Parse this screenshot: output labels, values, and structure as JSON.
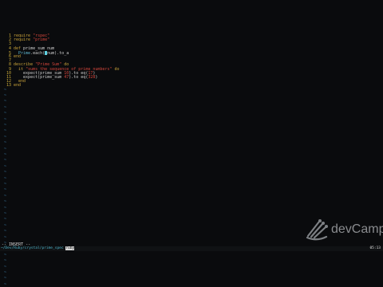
{
  "editor": {
    "lines": [
      {
        "n": "1",
        "segments": [
          {
            "t": "require ",
            "c": "kw"
          },
          {
            "t": "\"rspec\"",
            "c": "str"
          }
        ]
      },
      {
        "n": "2",
        "segments": [
          {
            "t": "require ",
            "c": "kw"
          },
          {
            "t": "\"prime\"",
            "c": "str"
          }
        ]
      },
      {
        "n": "3",
        "segments": []
      },
      {
        "n": "4",
        "segments": [
          {
            "t": "def ",
            "c": "kw"
          },
          {
            "t": "prime_sum ",
            "c": "fn"
          },
          {
            "t": "num",
            "c": "plain"
          }
        ]
      },
      {
        "n": "5",
        "segments": [
          {
            "t": "  Prime",
            "c": "cls"
          },
          {
            "t": ".each(",
            "c": "plain"
          },
          {
            "t": "CURSOR",
            "c": "cursor"
          },
          {
            "t": "num",
            "c": "plain"
          },
          {
            "t": ").to_a",
            "c": "plain"
          }
        ]
      },
      {
        "n": "6",
        "segments": [
          {
            "t": "end",
            "c": "kw"
          }
        ]
      },
      {
        "n": "7",
        "segments": []
      },
      {
        "n": "8",
        "segments": [
          {
            "t": "describe ",
            "c": "kw"
          },
          {
            "t": "\"Prime Sum\" ",
            "c": "str"
          },
          {
            "t": "do",
            "c": "kw"
          }
        ]
      },
      {
        "n": "9",
        "segments": [
          {
            "t": "  it ",
            "c": "kw"
          },
          {
            "t": "\"sums the sequence of prime numbers\" ",
            "c": "str"
          },
          {
            "t": "do",
            "c": "kw"
          }
        ]
      },
      {
        "n": "10",
        "segments": [
          {
            "t": "    expect(prime_sum ",
            "c": "plain"
          },
          {
            "t": "10",
            "c": "num"
          },
          {
            "t": ").to eq(",
            "c": "plain"
          },
          {
            "t": "17",
            "c": "num"
          },
          {
            "t": ")",
            "c": "plain"
          }
        ]
      },
      {
        "n": "11",
        "segments": [
          {
            "t": "    expect(prime_sum ",
            "c": "plain"
          },
          {
            "t": "47",
            "c": "num"
          },
          {
            "t": ").to eq(",
            "c": "plain"
          },
          {
            "t": "328",
            "c": "num"
          },
          {
            "t": ")",
            "c": "plain"
          }
        ]
      },
      {
        "n": "12",
        "segments": [
          {
            "t": "  end",
            "c": "kw"
          }
        ]
      },
      {
        "n": "13",
        "segments": [
          {
            "t": "end",
            "c": "kw"
          }
        ]
      }
    ],
    "tilde": "~",
    "tilde_count": 34
  },
  "mode_text": "-- INSERT --",
  "status": {
    "path": "~/Dev/Ruby/crystal/prime_spec",
    "highlight": "ruby",
    "right": "05:13"
  },
  "logo": {
    "text": "devCamp"
  },
  "colors": {
    "background": "#0a0b0d",
    "keyword": "#c8a23a",
    "string": "#d2453b",
    "class": "#5fb7d0",
    "tilde": "#3f82ad"
  }
}
